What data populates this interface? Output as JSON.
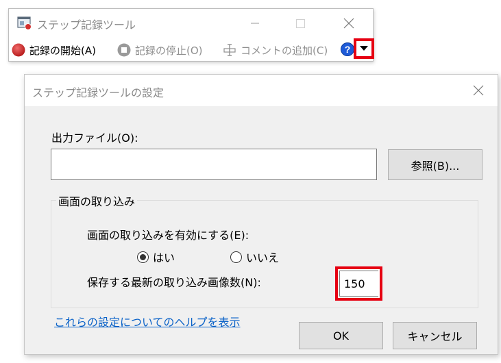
{
  "recorder": {
    "title": "ステップ記録ツール",
    "toolbar": {
      "start_label": "記録の開始(A)",
      "stop_label": "記録の停止(O)",
      "comment_label": "コメントの追加(C)"
    },
    "icons": {
      "app": "steps-recorder-icon",
      "start": "record-icon",
      "stop": "stop-icon",
      "comment": "comment-icon",
      "help": "help-icon",
      "dropdown": "dropdown-arrow-icon"
    },
    "colors": {
      "record_red": "#d32f2f",
      "help_blue": "#1e5bd8",
      "highlight_red": "#e60012"
    }
  },
  "settings_dialog": {
    "title": "ステップ記録ツールの設定",
    "output_file": {
      "label": "出力ファイル(O):",
      "value": ""
    },
    "browse_label": "参照(B)...",
    "capture_group": {
      "caption": "画面の取り込み",
      "enable_label": "画面の取り込みを有効にする(E):",
      "options": [
        "はい",
        "いいえ"
      ],
      "selected": "はい",
      "count_label": "保存する最新の取り込み画像数(N):",
      "count_value": "150"
    },
    "help_link": "これらの設定についてのヘルプを表示",
    "ok_label": "OK",
    "cancel_label": "キャンセル"
  }
}
